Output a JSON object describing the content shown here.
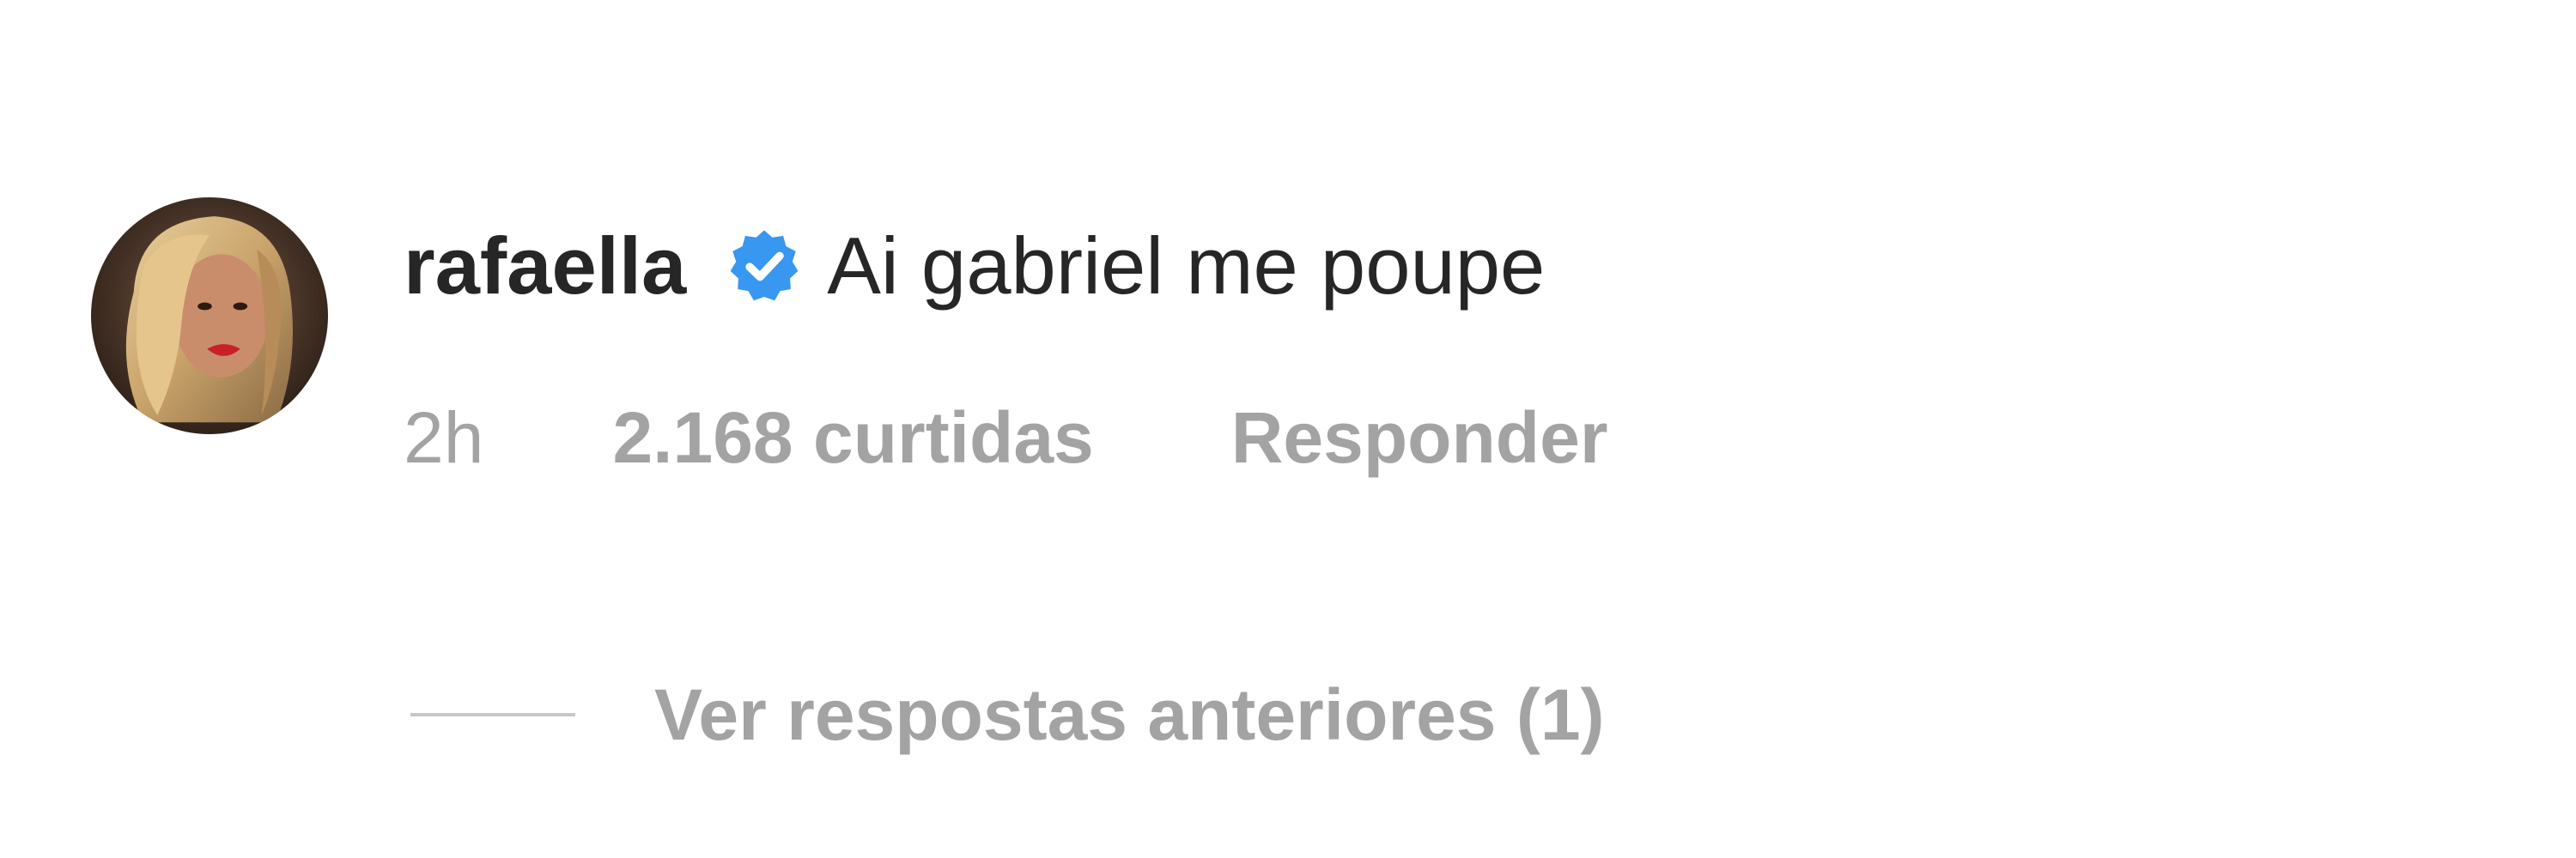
{
  "comment": {
    "username": "rafaella",
    "verified": true,
    "text": "Ai gabriel me poupe",
    "time": "2h",
    "likes": "2.168 curtidas",
    "reply_label": "Responder",
    "view_replies_label": "Ver respostas anteriores (1)"
  },
  "colors": {
    "primary_text": "#262626",
    "secondary_text": "#a3a3a3",
    "verified_blue": "#3897f0",
    "divider_line": "#c7c7c7",
    "background": "#ffffff"
  },
  "icons": {
    "verified": "verified-badge-icon",
    "avatar": "profile-photo"
  }
}
